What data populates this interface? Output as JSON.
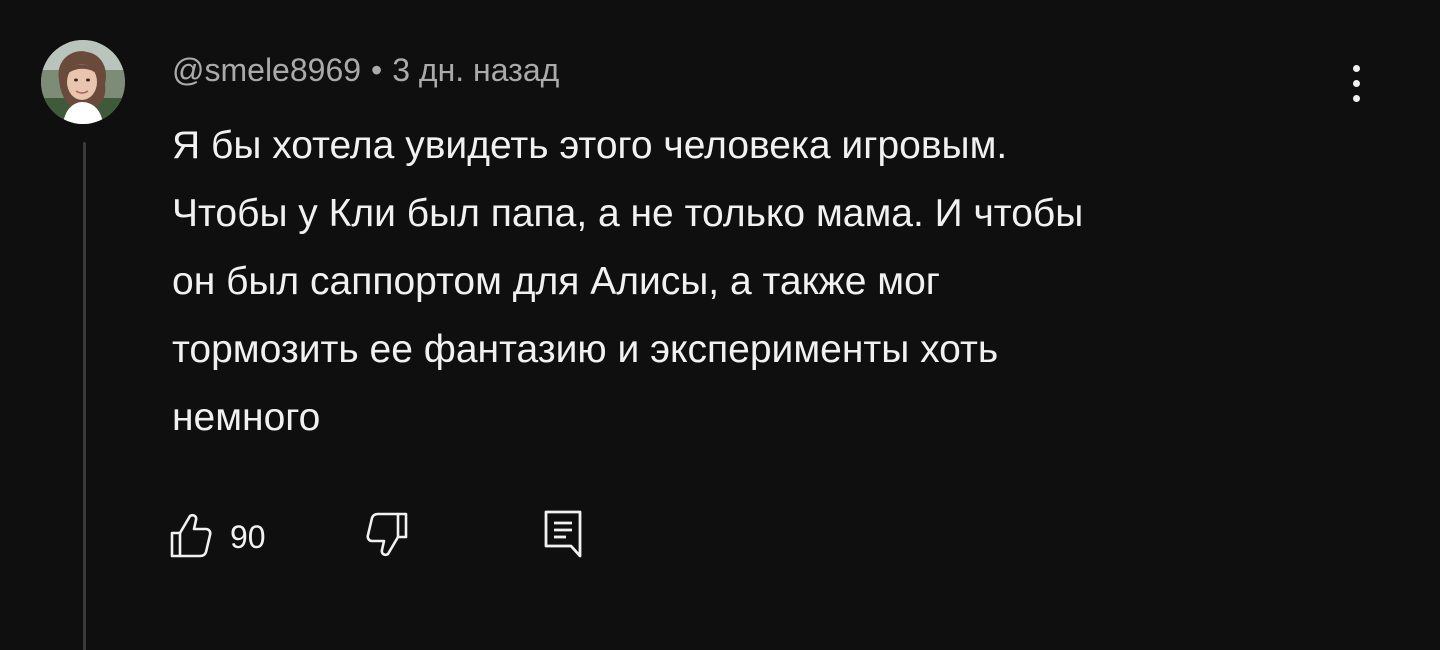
{
  "comment": {
    "author": "@smele8969",
    "separator": "•",
    "time": "3 дн. назад",
    "text_lines": [
      "Я бы хотела увидеть этого человека игровым.",
      "Чтобы у Кли был папа, а не только мама. И чтобы",
      "он был саппортом для Алисы, а также мог",
      "тормозить ее фантазию и эксперименты хоть",
      "немного"
    ],
    "likes": "90",
    "icons": {
      "avatar": "user-avatar",
      "menu": "more-vert-icon",
      "like": "thumb-up-icon",
      "dislike": "thumb-down-icon",
      "reply": "reply-comment-icon"
    }
  },
  "colors": {
    "background": "#0f0f0f",
    "text": "#f1f1f1",
    "meta_text": "#aaaaaa",
    "thread_line": "#3a3a3a"
  }
}
